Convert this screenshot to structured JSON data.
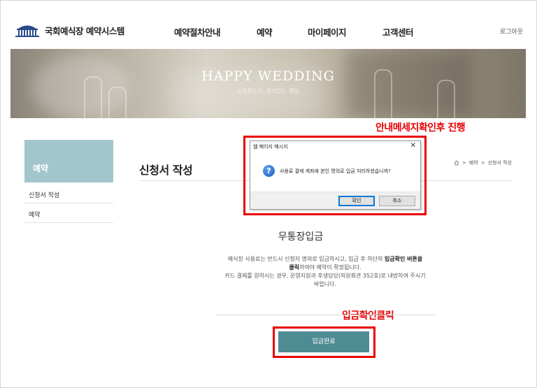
{
  "header": {
    "logo_text": "국회예식장 예약시스템",
    "nav": [
      "예약절차안내",
      "예약",
      "마이페이지",
      "고객센터"
    ],
    "login_label": "로그아웃"
  },
  "banner": {
    "title": "HAPPY WEDDING",
    "subtitle": "소중한순간, 품격있는 웨딩"
  },
  "sidebar": {
    "heading": "예약",
    "items": [
      "신청서 작성",
      "예약"
    ]
  },
  "main": {
    "page_title": "신청서 작성",
    "breadcrumb": [
      "예약",
      "신청서 작성"
    ],
    "section_title": "무통장입금",
    "notice_1": "예식장 사용료는 반드시 신청자 명의로 입금하시고, 입금 후 하단의",
    "notice_bold_1": "입금확인 버튼을",
    "notice_bold_2": "클릭",
    "notice_2": "하여야 예약이 확정됩니다.",
    "notice_3": "카드 결제를 원하시는 경우, 운영지원과 후생담당(의원회관 352호)로 내방하여 주시기",
    "notice_4": "바랍니다.",
    "confirm_button": "입금완료"
  },
  "dialog": {
    "title": "웹 페이지 메시지",
    "message": "사용료 결제 계좌에 본인 명의로 입금 처리하셨습니까?",
    "ok_label": "확인",
    "cancel_label": "취소"
  },
  "annotations": {
    "label_dialog": "안내메세지확인후 진행",
    "label_button": "입금확인클릭",
    "highlight_color": "#e80000"
  },
  "colors": {
    "accent": "#4f8b92",
    "sidebar_head": "#a3c6cc"
  }
}
